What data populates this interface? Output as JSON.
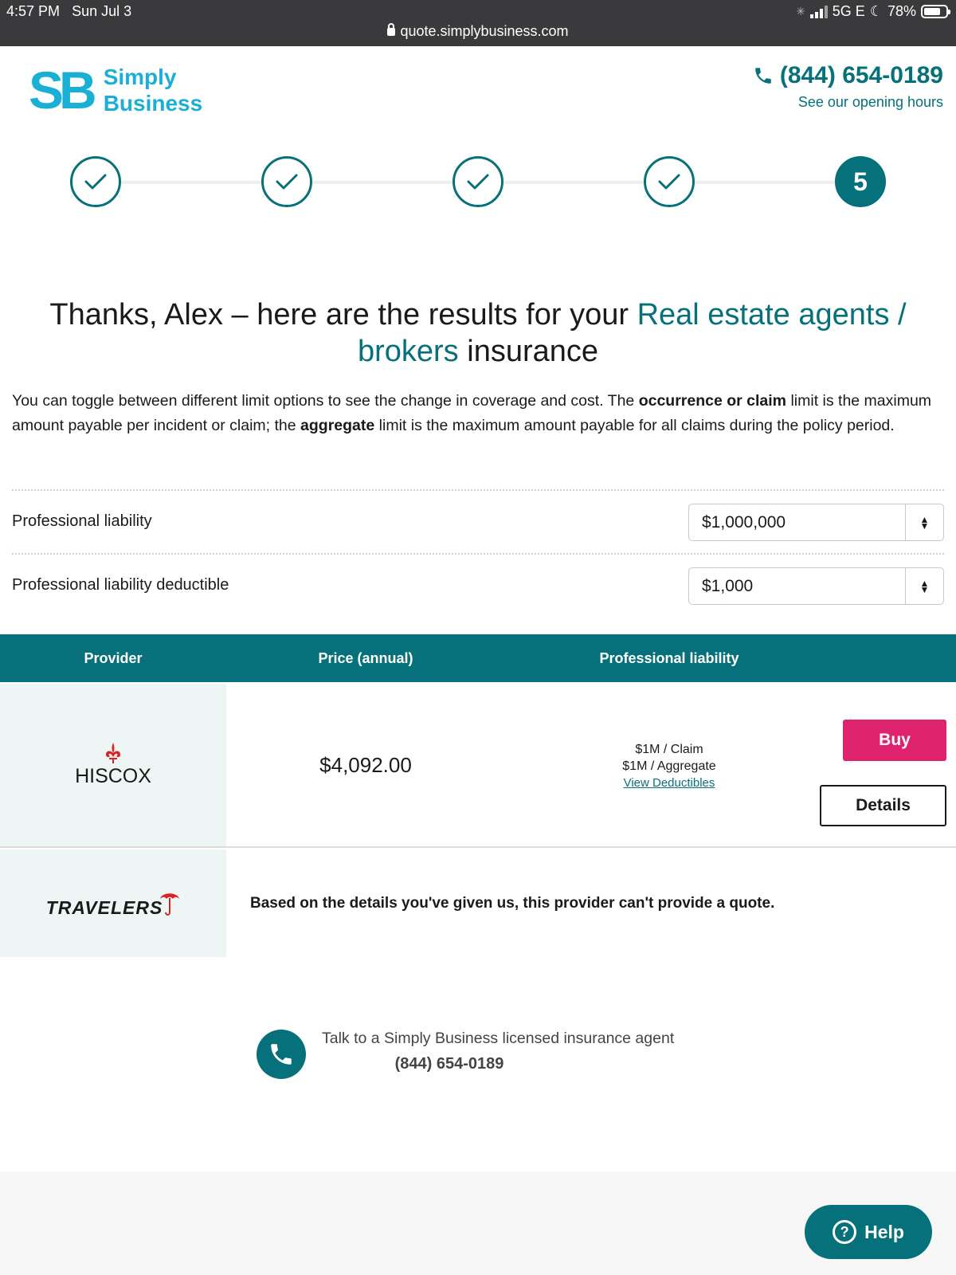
{
  "status_bar": {
    "time": "4:57 PM",
    "date": "Sun Jul 3",
    "network": "5G E",
    "battery": "78%",
    "battery_level": 0.78,
    "url": "quote.simplybusiness.com"
  },
  "header": {
    "logo_mark": "SB",
    "logo_line1": "Simply",
    "logo_line2": "Business",
    "phone": "(844) 654-0189",
    "hours_link": "See our opening hours"
  },
  "progress": {
    "current_step": "5",
    "completed_steps": 4
  },
  "heading": {
    "prefix": "Thanks, Alex – here are the results for your ",
    "accent": "Real estate agents / brokers",
    "suffix": " insurance"
  },
  "intro": {
    "part1": "You can toggle between different limit options to see the change in coverage and cost. The ",
    "bold1": "occurrence or claim",
    "part2": " limit is the maximum amount payable per incident or claim; the ",
    "bold2": "aggregate",
    "part3": " limit is the maximum amount payable for all claims during the policy period."
  },
  "options": {
    "liability_label": "Professional liability",
    "liability_value": "$1,000,000",
    "deductible_label": "Professional liability deductible",
    "deductible_value": "$1,000"
  },
  "table": {
    "headers": [
      "Provider",
      "Price (annual)",
      "Professional liability"
    ],
    "rows": [
      {
        "provider": "HISCOX",
        "price": "$4,092.00",
        "limit_claim": "$1M / Claim",
        "limit_aggregate": "$1M / Aggregate",
        "deductibles_link": "View Deductibles",
        "buy_label": "Buy",
        "details_label": "Details"
      },
      {
        "provider": "TRAVELERS",
        "message": "Based on the details you've given us, this provider can't provide a quote."
      }
    ]
  },
  "agent": {
    "text": "Talk to a Simply Business licensed insurance agent",
    "phone": "(844) 654-0189"
  },
  "help": {
    "label": "Help"
  },
  "colors": {
    "brand": "#06717a",
    "logo": "#1ab0d6",
    "buy": "#e0236f"
  }
}
